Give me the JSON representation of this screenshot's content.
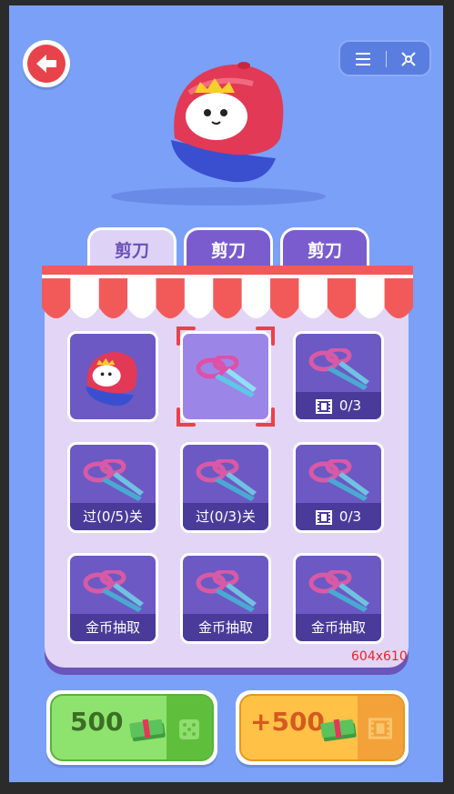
{
  "tabs": [
    {
      "label": "剪刀",
      "active": true
    },
    {
      "label": "剪刀",
      "active": false
    },
    {
      "label": "剪刀",
      "active": false
    }
  ],
  "slots": [
    {
      "item": "hat",
      "caption": "",
      "selected": false
    },
    {
      "item": "scissors",
      "caption": "",
      "selected": true
    },
    {
      "item": "scissors",
      "caption": "0/3",
      "icon": "film-icon"
    },
    {
      "item": "scissors",
      "caption": "过(0/5)关"
    },
    {
      "item": "scissors",
      "caption": "过(0/3)关"
    },
    {
      "item": "scissors",
      "caption": "0/3",
      "icon": "film-icon"
    },
    {
      "item": "scissors",
      "caption": "金币抽取"
    },
    {
      "item": "scissors",
      "caption": "金币抽取"
    },
    {
      "item": "scissors",
      "caption": "金币抽取"
    }
  ],
  "dimensions_label": "604x610",
  "buttons": {
    "coin_price": "500",
    "coin_icon": "dice-icon",
    "reward": "+500",
    "reward_icon": "film-icon"
  },
  "colors": {
    "background": "#7aa0f7",
    "panel": "#e2d5f5",
    "slot": "#6c59c4",
    "accent_red": "#e8424a",
    "green": "#8ee36e",
    "yellow": "#ffc247"
  }
}
